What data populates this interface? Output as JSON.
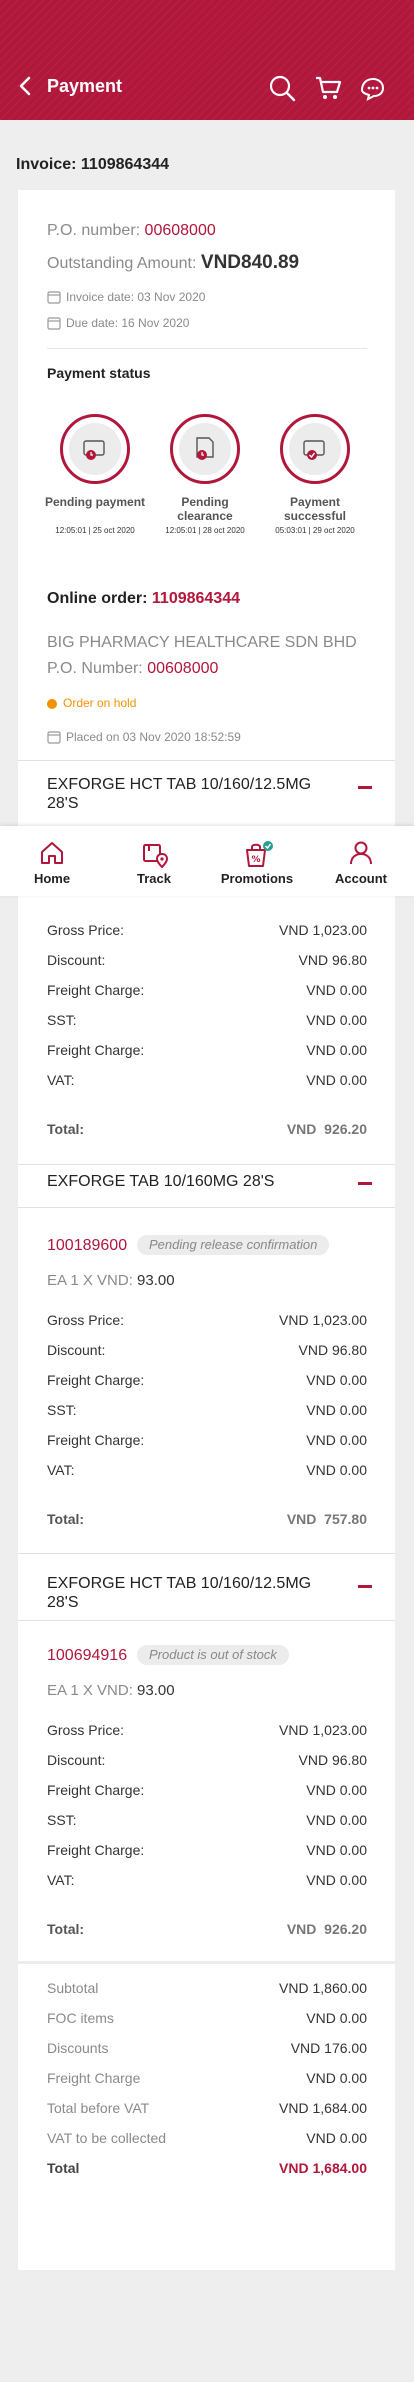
{
  "header": {
    "title": "Payment",
    "icons": [
      "back-arrow-icon",
      "search-icon",
      "cart-icon",
      "chat-icon"
    ]
  },
  "invoice_title": "Invoice: 1109864344",
  "summary": {
    "po_label": "P.O. number:",
    "po_value": "00608000",
    "outstanding_label": "Outstanding Amount:",
    "outstanding_value": "VND840.89",
    "invoice_date": "Invoice date: 03 Nov 2020",
    "due_date": "Due date: 16 Nov 2020"
  },
  "payment_status": {
    "title": "Payment status",
    "steps": [
      {
        "label": "Pending payment",
        "time": "12:05:01 | 25 oct 2020",
        "icon": "wallet-clock-icon"
      },
      {
        "label": "Pending clearance",
        "time": "12:05:01 | 28 oct 2020",
        "icon": "document-clock-icon"
      },
      {
        "label": "Payment successful",
        "time": "05:03:01 | 29 oct 2020",
        "icon": "wallet-check-icon"
      }
    ]
  },
  "online_order": {
    "label": "Online order:",
    "number": "1109864344",
    "company": "BIG PHARMACY HEALTHCARE SDN BHD",
    "po_label": "P.O. Number:",
    "po_value": "00608000",
    "status": "Order on hold",
    "placed": "Placed on 03 Nov 2020 18:52:59"
  },
  "products": [
    {
      "name": "EXFORGE HCT TAB 10/160/12.5MG 28'S",
      "gross": "VND 1,023.00",
      "discount": "VND 96.80",
      "freight1": "VND 0.00",
      "sst": "VND 0.00",
      "freight2": "VND 0.00",
      "vat": "VND 0.00",
      "total_currency": "VND",
      "total_amount": "926.20"
    },
    {
      "name": "EXFORGE TAB 10/160MG 28'S",
      "code": "100189600",
      "status": "Pending release confirmation",
      "qty_label": "EA 1 X VND:",
      "qty_value": "93.00",
      "gross": "VND 1,023.00",
      "discount": "VND 96.80",
      "freight1": "VND 0.00",
      "sst": "VND 0.00",
      "freight2": "VND 0.00",
      "vat": "VND 0.00",
      "total_currency": "VND",
      "total_amount": "757.80"
    },
    {
      "name": "EXFORGE HCT TAB 10/160/12.5MG 28'S",
      "code": "100694916",
      "status": "Product is out of stock",
      "qty_label": "EA 1 X VND:",
      "qty_value": "93.00",
      "gross": "VND 1,023.00",
      "discount": "VND 96.80",
      "freight1": "VND 0.00",
      "sst": "VND 0.00",
      "freight2": "VND 0.00",
      "vat": "VND 0.00",
      "total_currency": "VND",
      "total_amount": "926.20"
    }
  ],
  "line_labels": {
    "gross": "Gross Price:",
    "discount": "Discount:",
    "freight": "Freight Charge:",
    "sst": "SST:",
    "vat": "VAT:",
    "total": "Total:"
  },
  "totals": [
    {
      "label": "Subtotal",
      "value": "VND 1,860.00"
    },
    {
      "label": "FOC items",
      "value": "VND 0.00"
    },
    {
      "label": "Discounts",
      "value": "VND 176.00"
    },
    {
      "label": "Freight Charge",
      "value": "VND 0.00"
    },
    {
      "label": "Total before VAT",
      "value": "VND 1,684.00"
    },
    {
      "label": "VAT to be collected",
      "value": "VND 0.00"
    },
    {
      "label": "Total",
      "value": "VND 1,684.00"
    }
  ],
  "nav": [
    {
      "label": "Home",
      "icon": "home-icon"
    },
    {
      "label": "Track",
      "icon": "track-icon"
    },
    {
      "label": "Promotions",
      "icon": "promotions-icon"
    },
    {
      "label": "Account",
      "icon": "account-icon"
    }
  ],
  "colors": {
    "brand": "#b1163b",
    "warning": "#f39200",
    "promo_badge": "#2a9d8f"
  }
}
